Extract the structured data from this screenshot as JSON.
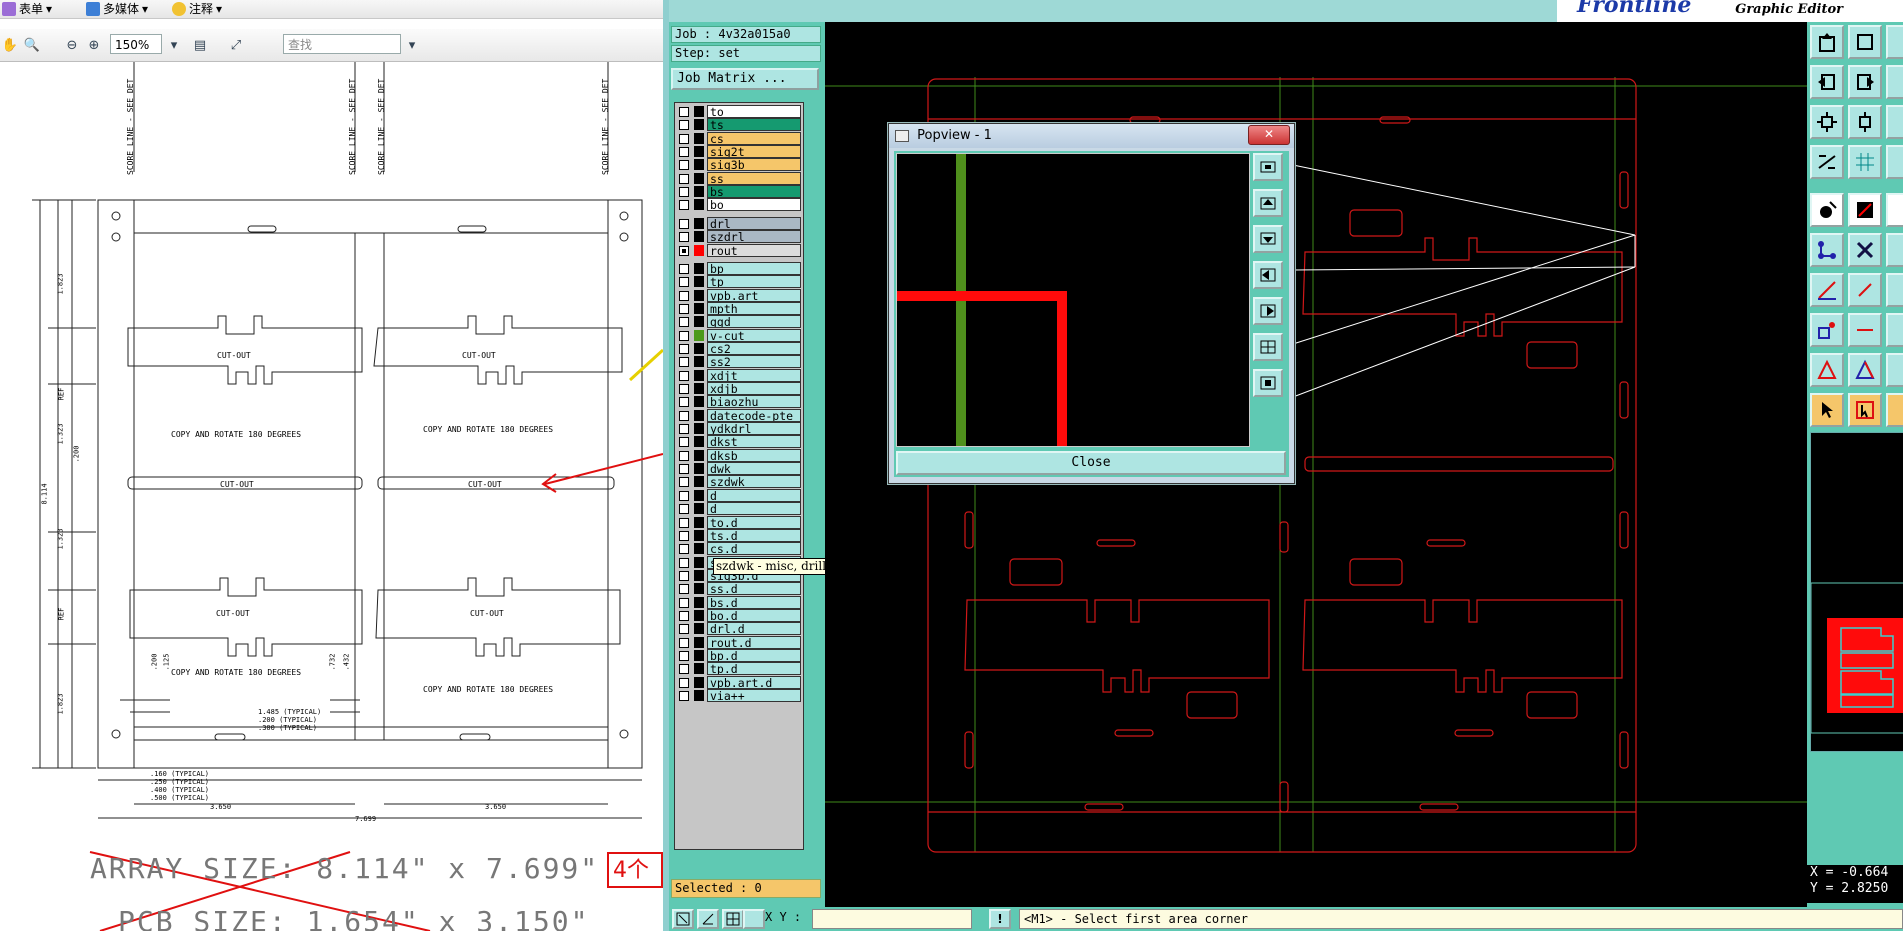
{
  "pdf_viewer": {
    "menu": [
      {
        "label": "表单",
        "icon": "form-icon"
      },
      {
        "label": "多媒体",
        "icon": "multimedia-icon"
      },
      {
        "label": "注释",
        "icon": "comment-icon"
      }
    ],
    "zoom": "150%",
    "find_placeholder": "查找",
    "drawing": {
      "score_line_label": "SCORE LINE - SEE DET",
      "cut_out": "CUT-OUT",
      "copy_rotate": "COPY AND ROTATE 180 DEGREES",
      "dims": {
        "h1": "1.823",
        "h2": "REF",
        "h3": "1.323",
        "h4": "8.114",
        "h5": "1.323",
        "h6": "REF",
        "h7": "1.823",
        "h8": ".200",
        "w1": "3.650",
        "w2": "3.650",
        "w_total": "7.699",
        "t1": ".160 (TYPICAL)",
        "t2": ".250 (TYPICAL)",
        "t3": ".400 (TYPICAL)",
        "t4": ".500 (TYPICAL)",
        "s1": "1.485 (TYPICAL)",
        "s2": ".200 (TYPICAL)",
        "s3": ".300 (TYPICAL)",
        "v1": ".200",
        "v2": ".125",
        "v3": ".732",
        "v4": ".432"
      },
      "array_size": "ARRAY SIZE: 8.114\" x 7.699\"",
      "pcb_size": "PCB SIZE: 1.654\" x 3.150\"",
      "note_red": "4个"
    }
  },
  "frontline": {
    "logo": "Frontline",
    "logo_sub": "Graphic Editor",
    "job": "Job : 4v32a015a0",
    "step": "Step: set",
    "job_matrix": "Job Matrix ...",
    "selected": "Selected : 0",
    "xy_label": "X Y :",
    "status_message": "<M1> - Select first area corner",
    "coord_x": "X = -0.664",
    "coord_y": "Y = 2.8250",
    "tooltip": "szdwk - misc, drill, positive",
    "layers": [
      {
        "name": "to",
        "color": "#ffffff",
        "swatch": "#000000"
      },
      {
        "name": "ts",
        "color": "#159a70",
        "swatch": "#000000"
      },
      {
        "name": "cs",
        "color": "#f5c66a",
        "swatch": "#000000"
      },
      {
        "name": "sig2t",
        "color": "#f5c66a",
        "swatch": "#000000"
      },
      {
        "name": "sig3b",
        "color": "#f5c66a",
        "swatch": "#000000"
      },
      {
        "name": "ss",
        "color": "#f5c66a",
        "swatch": "#000000"
      },
      {
        "name": "bs",
        "color": "#159a70",
        "swatch": "#000000"
      },
      {
        "name": "bo",
        "color": "#ffffff",
        "swatch": "#000000"
      },
      {
        "name": "drl",
        "color": "#aab8c4",
        "swatch": "#000000"
      },
      {
        "name": "szdrl",
        "color": "#aab8c4",
        "swatch": "#000000"
      },
      {
        "name": "rout",
        "color": "#dcdcdc",
        "swatch": "#ff0000",
        "active": true
      },
      {
        "name": "bp",
        "color": "#aee5e2",
        "swatch": "#000000"
      },
      {
        "name": "tp",
        "color": "#aee5e2",
        "swatch": "#000000"
      },
      {
        "name": "vpb.art",
        "color": "#aee5e2",
        "swatch": "#000000"
      },
      {
        "name": "mpth",
        "color": "#aee5e2",
        "swatch": "#000000"
      },
      {
        "name": "ggd",
        "color": "#aee5e2",
        "swatch": "#000000"
      },
      {
        "name": "v-cut",
        "color": "#aee5e2",
        "swatch": "#4c9a1a"
      },
      {
        "name": "cs2",
        "color": "#aee5e2",
        "swatch": "#000000"
      },
      {
        "name": "ss2",
        "color": "#aee5e2",
        "swatch": "#000000"
      },
      {
        "name": "xdjt",
        "color": "#aee5e2",
        "swatch": "#000000"
      },
      {
        "name": "xdjb",
        "color": "#aee5e2",
        "swatch": "#000000"
      },
      {
        "name": "biaozhu",
        "color": "#aee5e2",
        "swatch": "#000000"
      },
      {
        "name": "datecode-pte",
        "color": "#aee5e2",
        "swatch": "#000000"
      },
      {
        "name": "ydkdrl",
        "color": "#aee5e2",
        "swatch": "#000000"
      },
      {
        "name": "dkst",
        "color": "#aee5e2",
        "swatch": "#000000"
      },
      {
        "name": "dksb",
        "color": "#aee5e2",
        "swatch": "#000000"
      },
      {
        "name": "dwk",
        "color": "#aee5e2",
        "swatch": "#000000"
      },
      {
        "name": "szdwk",
        "color": "#aee5e2",
        "swatch": "#000000"
      },
      {
        "name": "d",
        "color": "#aee5e2",
        "swatch": "#000000"
      },
      {
        "name": "d",
        "color": "#aee5e2",
        "swatch": "#000000"
      },
      {
        "name": "to.d",
        "color": "#aee5e2",
        "swatch": "#000000"
      },
      {
        "name": "ts.d",
        "color": "#aee5e2",
        "swatch": "#000000"
      },
      {
        "name": "cs.d",
        "color": "#aee5e2",
        "swatch": "#000000"
      },
      {
        "name": "sig2t.d",
        "color": "#aee5e2",
        "swatch": "#000000"
      },
      {
        "name": "sig3b.d",
        "color": "#aee5e2",
        "swatch": "#000000"
      },
      {
        "name": "ss.d",
        "color": "#aee5e2",
        "swatch": "#000000"
      },
      {
        "name": "bs.d",
        "color": "#aee5e2",
        "swatch": "#000000"
      },
      {
        "name": "bo.d",
        "color": "#aee5e2",
        "swatch": "#000000"
      },
      {
        "name": "drl.d",
        "color": "#aee5e2",
        "swatch": "#000000"
      },
      {
        "name": "rout.d",
        "color": "#aee5e2",
        "swatch": "#000000"
      },
      {
        "name": "bp.d",
        "color": "#aee5e2",
        "swatch": "#000000"
      },
      {
        "name": "tp.d",
        "color": "#aee5e2",
        "swatch": "#000000"
      },
      {
        "name": "vpb.art.d",
        "color": "#aee5e2",
        "swatch": "#000000"
      },
      {
        "name": "via++",
        "color": "#aee5e2",
        "swatch": "#000000"
      }
    ],
    "popview": {
      "title": "Popview - 1",
      "close": "Close"
    }
  }
}
